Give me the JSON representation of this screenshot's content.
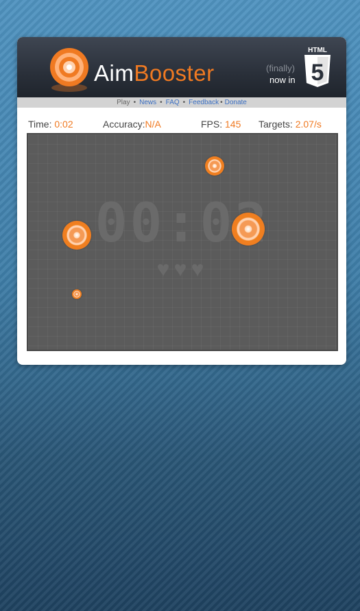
{
  "header": {
    "logo_aim": "Aim",
    "logo_booster": "Booster",
    "finally": "(finally)",
    "now_in": "now in",
    "html5_label": "HTML",
    "html5_number": "5"
  },
  "nav": {
    "items": [
      "Play",
      "News",
      "FAQ",
      "Feedback",
      "Donate"
    ]
  },
  "stats": {
    "time_label": "Time:",
    "time_value": "0:02",
    "accuracy_label": "Accuracy:",
    "accuracy_value": "N/A",
    "fps_label": "FPS:",
    "fps_value": "145",
    "targets_label": "Targets:",
    "targets_value": "2.07/s"
  },
  "game": {
    "timer_display": "00:02",
    "hearts": "♥♥♥"
  },
  "colors": {
    "accent": "#f07a22",
    "link": "#3b6fc2",
    "arena": "#5b5b5b"
  }
}
